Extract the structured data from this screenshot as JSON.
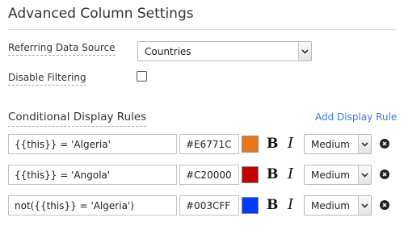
{
  "header": {
    "title": "Advanced Column Settings"
  },
  "form": {
    "data_source": {
      "label": "Referring Data Source",
      "value": "Countries"
    },
    "disable_filtering": {
      "label": "Disable Filtering",
      "checked": false
    }
  },
  "rules_section": {
    "title": "Conditional Display Rules",
    "add_label": "Add Display Rule",
    "bold_label": "B",
    "italic_label": "I",
    "rules": [
      {
        "condition": "{{this}} = 'Algeria'",
        "color": "#E6771C",
        "size": "Medium"
      },
      {
        "condition": "{{this}} = 'Angola'",
        "color": "#C20000",
        "size": "Medium"
      },
      {
        "condition": "not({{this}} = 'Algeria')",
        "color": "#003CFF",
        "size": "Medium"
      }
    ]
  },
  "icons": {
    "dropdown": "chevron-down-icon",
    "remove": "remove-circle-icon"
  }
}
